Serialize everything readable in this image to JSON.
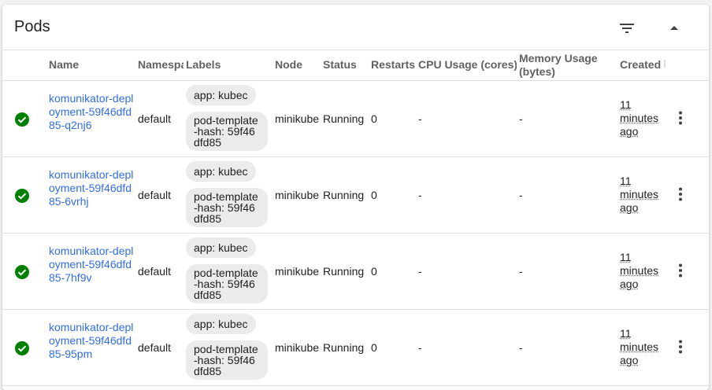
{
  "card": {
    "title": "Pods"
  },
  "header_icons": {
    "filter": "filter-list-icon",
    "collapse": "arrow-up-icon"
  },
  "columns": {
    "name": "Name",
    "namespace": "Namespace",
    "labels": "Labels",
    "node": "Node",
    "status": "Status",
    "restarts": "Restarts",
    "cpu": "CPU Usage (cores)",
    "memory": "Memory Usage (bytes)",
    "created": "Created"
  },
  "colors": {
    "link": "#326de6",
    "status_ok": "#008000",
    "chip_bg": "#ebebeb"
  },
  "pods": [
    {
      "name": "komunikator-deployment-59f46dfd85-q2nj6",
      "namespace": "default",
      "labels": [
        "app: kubec",
        "pod-template-hash: 59f46dfd85"
      ],
      "node": "minikube",
      "status": "Running",
      "restarts": "0",
      "cpu": "-",
      "memory": "-",
      "created": "11 minutes ago"
    },
    {
      "name": "komunikator-deployment-59f46dfd85-6vrhj",
      "namespace": "default",
      "labels": [
        "app: kubec",
        "pod-template-hash: 59f46dfd85"
      ],
      "node": "minikube",
      "status": "Running",
      "restarts": "0",
      "cpu": "-",
      "memory": "-",
      "created": "11 minutes ago"
    },
    {
      "name": "komunikator-deployment-59f46dfd85-7hf9v",
      "namespace": "default",
      "labels": [
        "app: kubec",
        "pod-template-hash: 59f46dfd85"
      ],
      "node": "minikube",
      "status": "Running",
      "restarts": "0",
      "cpu": "-",
      "memory": "-",
      "created": "11 minutes ago"
    },
    {
      "name": "komunikator-deployment-59f46dfd85-95pm",
      "namespace": "default",
      "labels": [
        "app: kubec",
        "pod-template-hash: 59f46dfd85"
      ],
      "node": "minikube",
      "status": "Running",
      "restarts": "0",
      "cpu": "-",
      "memory": "-",
      "created": "11 minutes ago"
    }
  ]
}
